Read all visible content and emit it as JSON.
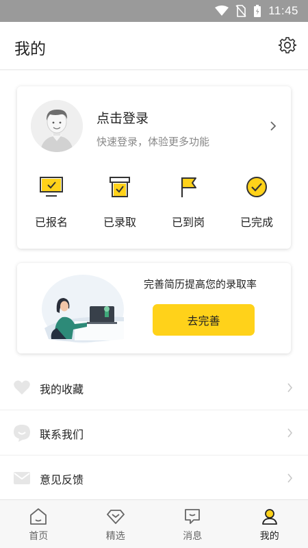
{
  "status_bar": {
    "time": "11:45"
  },
  "header": {
    "title": "我的"
  },
  "profile": {
    "login_title": "点击登录",
    "login_subtitle": "快速登录，体验更多功能",
    "statuses": [
      {
        "label": "已报名",
        "icon": "monitor-check-icon"
      },
      {
        "label": "已录取",
        "icon": "box-check-icon"
      },
      {
        "label": "已到岗",
        "icon": "flag-icon"
      },
      {
        "label": "已完成",
        "icon": "check-circle-icon"
      }
    ]
  },
  "resume": {
    "text": "完善简历提高您的录取率",
    "button_label": "去完善"
  },
  "menu": {
    "items": [
      {
        "label": "我的收藏",
        "icon": "heart-icon"
      },
      {
        "label": "联系我们",
        "icon": "chat-bubble-icon"
      },
      {
        "label": "意见反馈",
        "icon": "mail-icon"
      }
    ]
  },
  "tabs": [
    {
      "label": "首页",
      "icon": "home-icon",
      "active": false
    },
    {
      "label": "精选",
      "icon": "diamond-icon",
      "active": false
    },
    {
      "label": "消息",
      "icon": "message-icon",
      "active": false
    },
    {
      "label": "我的",
      "icon": "user-icon",
      "active": true
    }
  ],
  "colors": {
    "accent": "#ffd21a",
    "status_bar": "#9a9a9a",
    "text": "#222222",
    "muted": "#888888"
  }
}
